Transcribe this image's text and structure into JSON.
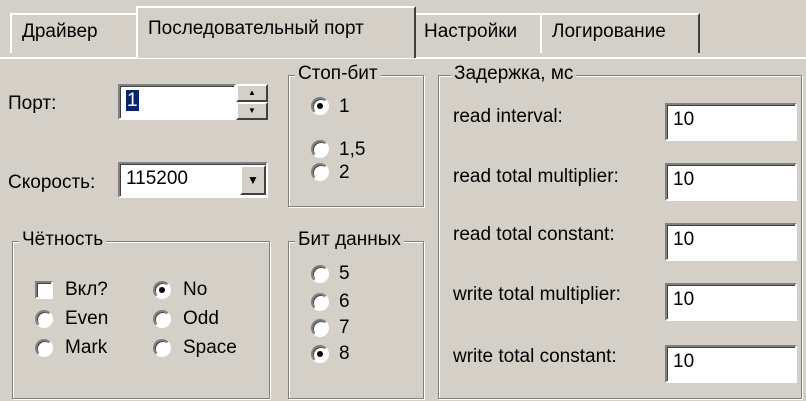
{
  "tabs": [
    "Драйвер",
    "Последовательный порт",
    "Настройки",
    "Логирование"
  ],
  "port": {
    "label": "Порт:",
    "value": "1",
    "up_icon": "▲",
    "down_icon": "▼"
  },
  "speed": {
    "label": "Скорость:",
    "value": "115200",
    "arrow_icon": "▼"
  },
  "stop_bits": {
    "title": "Стоп-бит",
    "options": [
      "1",
      "1,5",
      "2"
    ],
    "selected": "1"
  },
  "parity": {
    "title": "Чётность",
    "enable_label": "Вкл?",
    "enabled": false,
    "options": [
      "No",
      "Even",
      "Odd",
      "Mark",
      "Space"
    ],
    "selected": "No"
  },
  "data_bits": {
    "title": "Бит данных",
    "options": [
      "5",
      "6",
      "7",
      "8"
    ],
    "selected": "8"
  },
  "delay": {
    "title": "Задержка, мс",
    "rows": [
      {
        "label": "read interval:",
        "value": "10"
      },
      {
        "label": "read total multiplier:",
        "value": "10"
      },
      {
        "label": "read total constant:",
        "value": "10"
      },
      {
        "label": "write total multiplier:",
        "value": "10"
      },
      {
        "label": "write total constant:",
        "value": "10"
      }
    ]
  }
}
